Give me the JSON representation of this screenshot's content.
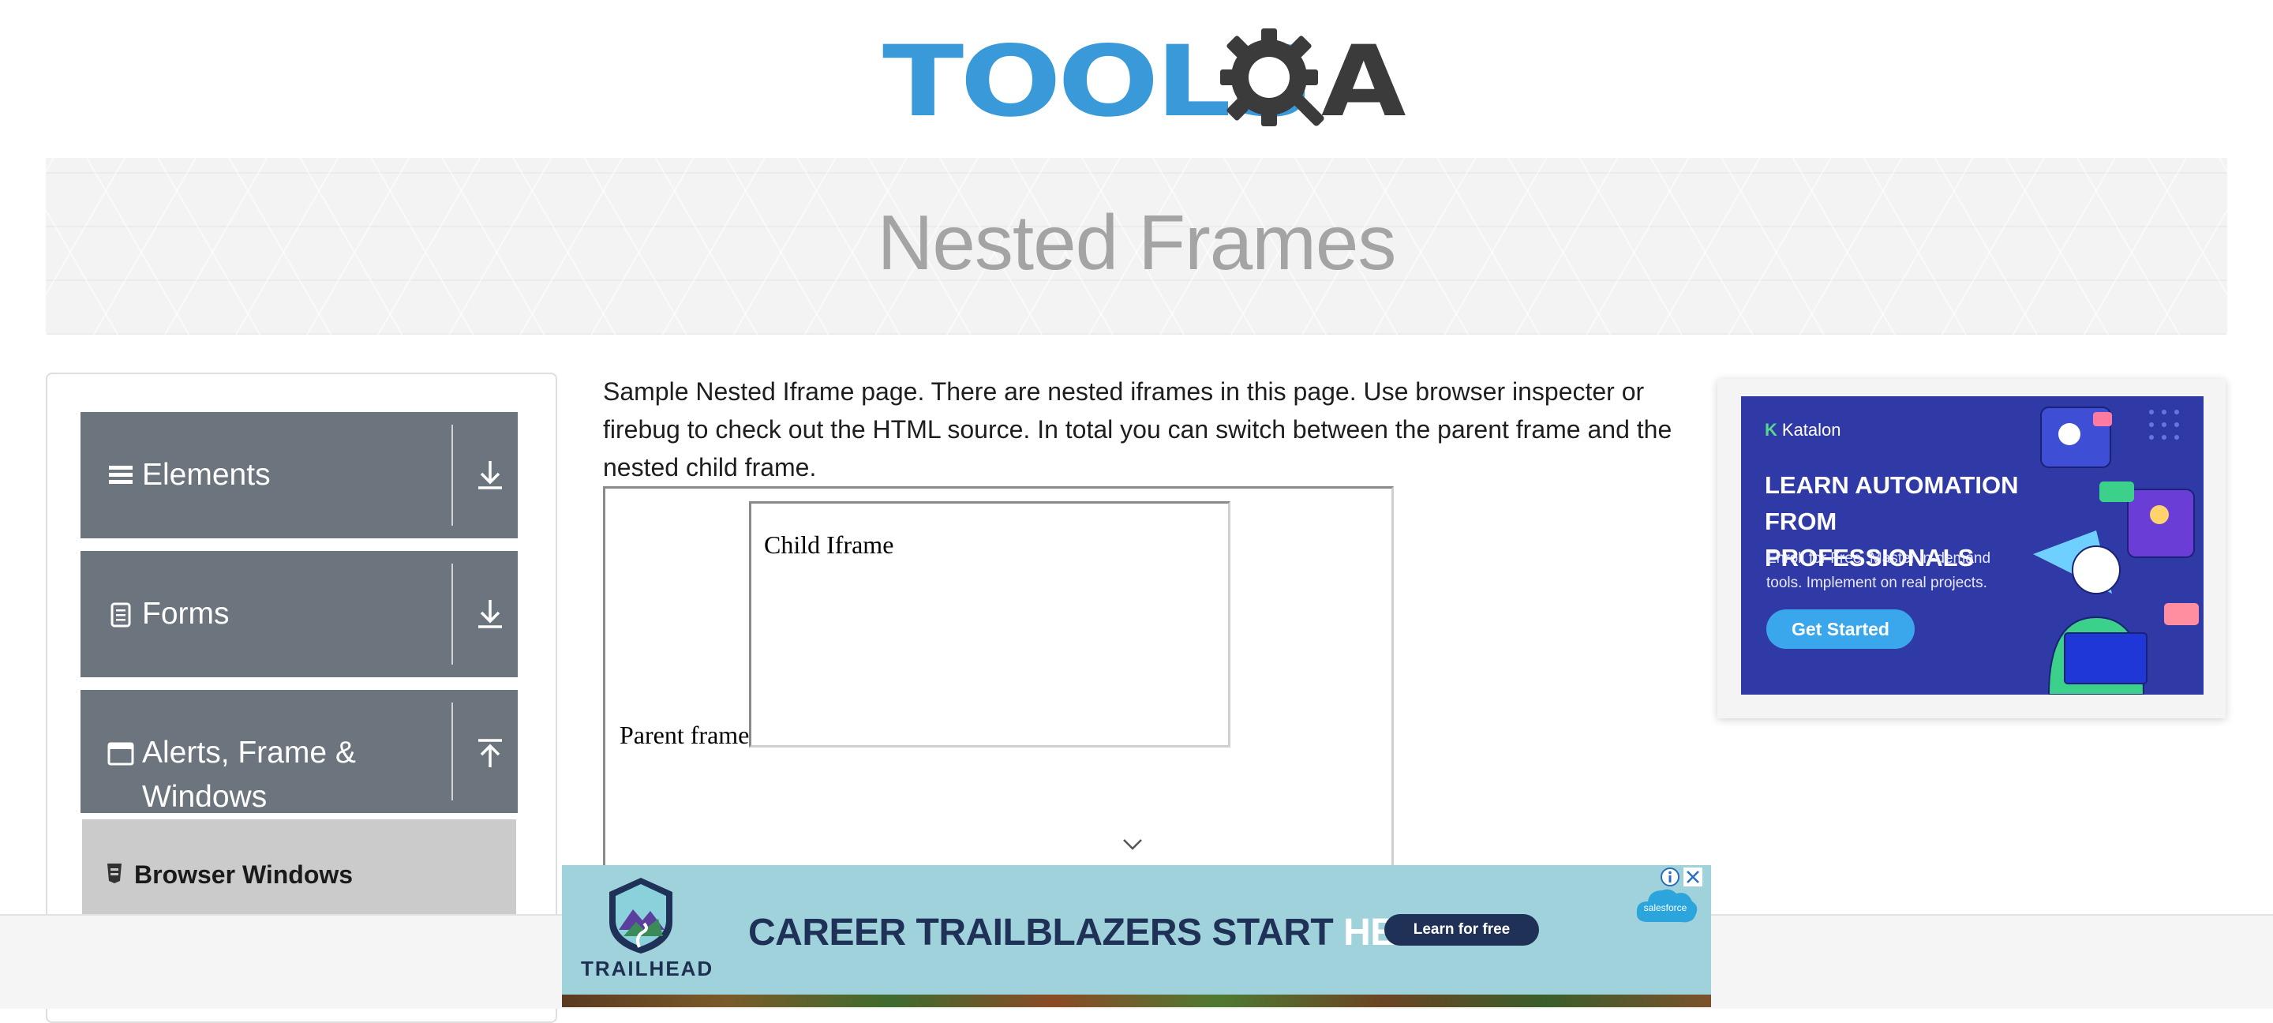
{
  "header": {
    "logo_text_primary": "TOOLS",
    "logo_text_secondary": "A",
    "logo_icon": "gear-magnifier-icon"
  },
  "banner": {
    "title": "Nested Frames"
  },
  "sidebar": {
    "groups": [
      {
        "label": "Elements",
        "icon": "hamburger-icon",
        "state": "collapsed"
      },
      {
        "label": "Forms",
        "icon": "document-icon",
        "state": "collapsed"
      },
      {
        "label": "Alerts, Frame &\nWindows",
        "icon": "window-icon",
        "state": "expanded"
      }
    ],
    "sub_items": [
      {
        "label": "Browser Windows",
        "icon": "browser-icon"
      }
    ]
  },
  "main": {
    "intro": "Sample Nested Iframe page. There are nested iframes in this page. Use browser inspecter or firebug to check out the HTML source. In total you can switch between the parent frame and the nested child frame.",
    "parent_frame_label": "Parent frame",
    "child_frame_label": "Child Iframe"
  },
  "ad_right": {
    "brand": "Katalon",
    "headline": "LEARN AUTOMATION FROM PROFESSIONALS",
    "subtext": "Enroll for Free. Master in-demand tools. Implement on real projects.",
    "button": "Get Started",
    "bg_color": "#2f3aa7",
    "button_color": "#3aa7ec"
  },
  "ad_bottom": {
    "brand": "TRAILHEAD",
    "headline_dark": "CAREER TRAILBLAZERS START ",
    "headline_light": "HERE.",
    "button": "Learn for free",
    "partner": "salesforce",
    "bg_color": "#9fd2da"
  },
  "colors": {
    "sidebar_group_bg": "#6c757d",
    "sidebar_subitem_active_bg": "#cbcbcb",
    "logo_blue": "#3a9ad9",
    "logo_dark": "#3b3b3b",
    "banner_title": "#a4a4a4"
  }
}
